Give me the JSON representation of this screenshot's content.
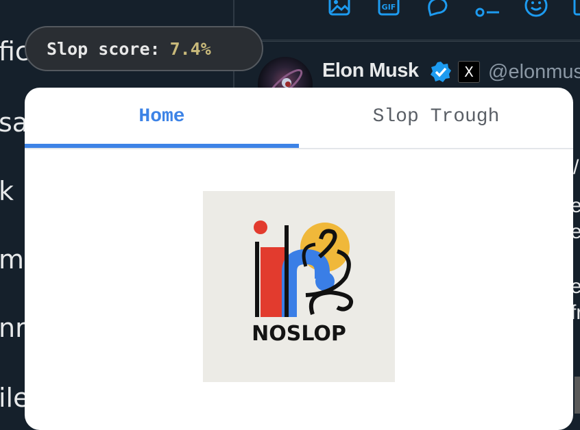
{
  "background": {
    "left_nav_fragments": [
      "fic",
      "sa",
      "k",
      "miu",
      "nm",
      "ile"
    ],
    "tweet": {
      "author_name": "Elon Musk",
      "handle": "@elonmus",
      "verified_badge": "verified-icon",
      "account_badge": "X"
    },
    "right_fragments": [
      "/",
      "e",
      "e",
      "es",
      "fr"
    ]
  },
  "slop_score": {
    "label": "Slop score:",
    "value": "7.4%"
  },
  "popup": {
    "tabs": [
      {
        "label": "Home",
        "active": true
      },
      {
        "label": "Slop Trough",
        "active": false
      }
    ],
    "logo_text": "NOSLOP"
  },
  "colors": {
    "accent": "#3d83e6",
    "score_value": "#c8b97a",
    "twitter_blue": "#1d9bf0"
  }
}
